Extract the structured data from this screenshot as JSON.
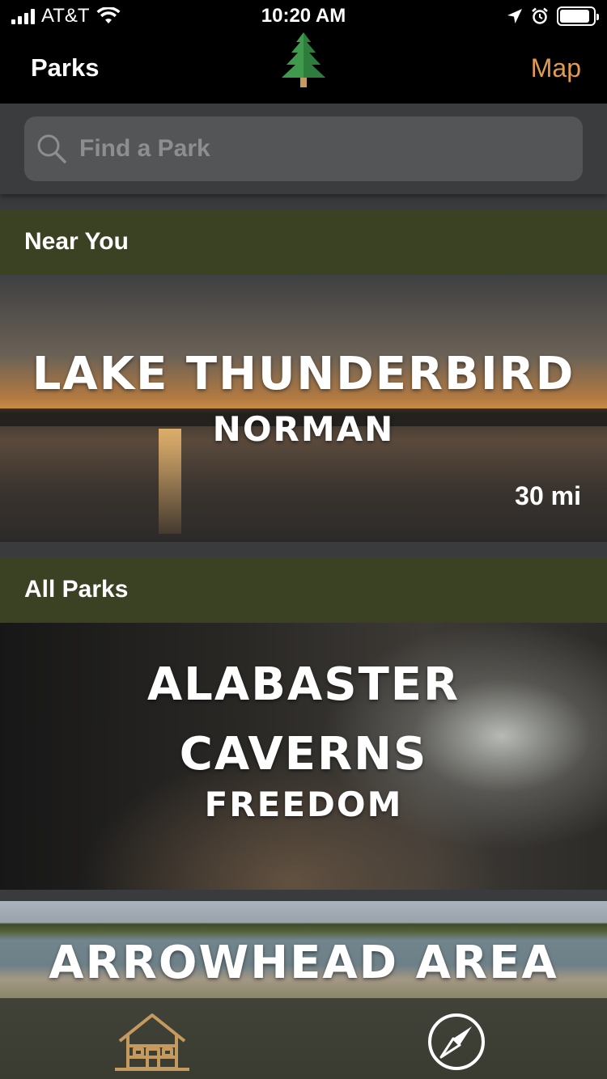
{
  "status_bar": {
    "carrier": "AT&T",
    "time": "10:20 AM",
    "battery_level": 0.9
  },
  "nav": {
    "title": "Parks",
    "logo_icon": "pine-tree-icon",
    "map_label": "Map",
    "map_color": "#e29a4f"
  },
  "search": {
    "placeholder": "Find a Park",
    "value": ""
  },
  "sections": {
    "near_you": "Near You",
    "all_parks": "All Parks"
  },
  "near_you_park": {
    "name": "Lake Thunderbird",
    "city": "Norman",
    "distance": "30 mi"
  },
  "all_parks": [
    {
      "name_line1": "Alabaster",
      "name_line2": "Caverns",
      "city": "Freedom"
    },
    {
      "name": "Arrowhead Area"
    }
  ],
  "tab_bar": {
    "tabs": [
      {
        "icon": "cabin-icon",
        "active": true,
        "active_color": "#c49a5e"
      },
      {
        "icon": "compass-icon",
        "active": false
      }
    ]
  },
  "colors": {
    "section_header": "#3b4123",
    "background": "#3a3b3c"
  }
}
